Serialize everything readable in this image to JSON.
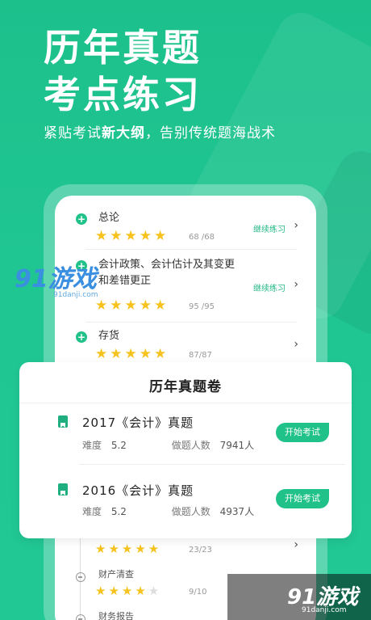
{
  "hero": {
    "title_line1": "历年真题",
    "title_line2": "考点练习",
    "subtitle_a": "紧贴考试",
    "subtitle_b": "新大纲",
    "subtitle_c": "，告别",
    "subtitle_d": "传统题海战术"
  },
  "chapters": [
    {
      "title": "总论",
      "stars": "★★★★★",
      "count": "68 /68",
      "continue": "继续练习"
    },
    {
      "title": "会计政策、会计估计及其变更和差错更正",
      "stars": "★★★★★",
      "count": "95 /95",
      "continue": "继续练习"
    },
    {
      "title": "存货",
      "stars": "★★★★★",
      "count": "87/87",
      "continue": ""
    }
  ],
  "card": {
    "title": "历年真题卷",
    "papers": [
      {
        "name": "2017《会计》真题",
        "difficulty_label": "难度",
        "difficulty": "5.2",
        "people_label": "做题人数",
        "people": "7941人",
        "button": "开始考试"
      },
      {
        "name": "2016《会计》真题",
        "difficulty_label": "难度",
        "difficulty": "5.2",
        "people_label": "做题人数",
        "people": "4937人",
        "button": "开始考试"
      }
    ]
  },
  "lower": [
    {
      "stars": "★★★★★",
      "count": "23/23"
    },
    {
      "title": "财产清查",
      "stars": "★★★★",
      "star_empty": "★",
      "count": "9/10"
    },
    {
      "title": "财务报告"
    }
  ],
  "watermark": {
    "left_logo": "91游戏",
    "left_url": "91danji.com",
    "br_logo": "91游戏",
    "br_url": "91danji.com"
  },
  "colors": {
    "brand": "#21c28a",
    "star": "#f6c21d"
  }
}
